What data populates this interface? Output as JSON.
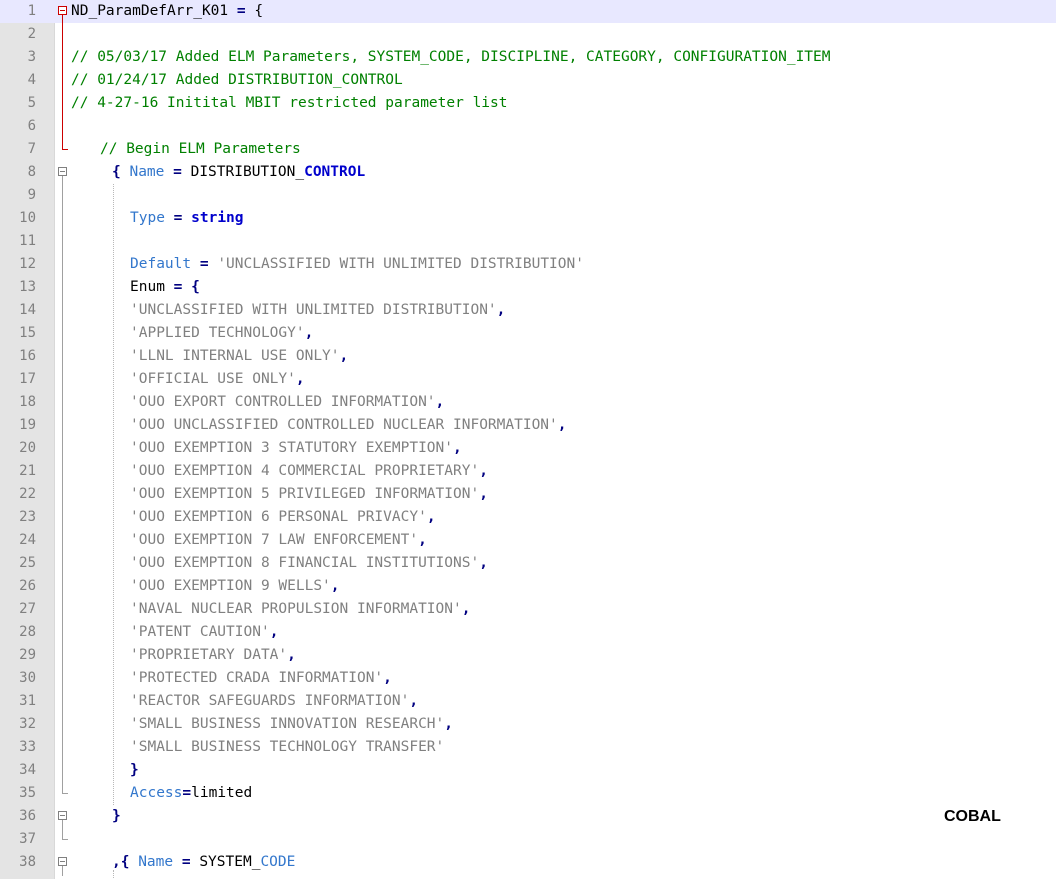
{
  "editor": {
    "lines": [
      {
        "n": "1",
        "indent": 0,
        "current": true,
        "tokens": [
          {
            "t": "ND_ParamDefArr_K01 ",
            "c": "id"
          },
          {
            "t": "=",
            "c": "op"
          },
          {
            "t": " {",
            "c": "id"
          }
        ]
      },
      {
        "n": "2",
        "indent": 0,
        "tokens": []
      },
      {
        "n": "3",
        "indent": 0,
        "tokens": [
          {
            "t": "// 05/03/17 Added ELM Parameters, SYSTEM_CODE, DISCIPLINE, CATEGORY, CONFIGURATION_ITEM",
            "c": "cmt"
          }
        ]
      },
      {
        "n": "4",
        "indent": 0,
        "tokens": [
          {
            "t": "// 01/24/17 Added DISTRIBUTION_CONTROL",
            "c": "cmt"
          }
        ]
      },
      {
        "n": "5",
        "indent": 0,
        "tokens": [
          {
            "t": "// 4-27-16 Initital MBIT restricted parameter list",
            "c": "cmt"
          }
        ]
      },
      {
        "n": "6",
        "indent": 0,
        "tokens": []
      },
      {
        "n": "7",
        "indent": 1,
        "tokens": [
          {
            "t": "// Begin ELM Parameters",
            "c": "cmt"
          }
        ]
      },
      {
        "n": "8",
        "indent": 2,
        "tokens": [
          {
            "t": "{ ",
            "c": "op"
          },
          {
            "t": "Name",
            "c": "kw"
          },
          {
            "t": " = ",
            "c": "op"
          },
          {
            "t": "DISTRIBUTION_",
            "c": "id"
          },
          {
            "t": "CONTROL",
            "c": "ctl"
          }
        ]
      },
      {
        "n": "9",
        "indent": 3,
        "tokens": []
      },
      {
        "n": "10",
        "indent": 3,
        "tokens": [
          {
            "t": "Type",
            "c": "kw"
          },
          {
            "t": " = ",
            "c": "op"
          },
          {
            "t": "string",
            "c": "type"
          }
        ]
      },
      {
        "n": "11",
        "indent": 3,
        "tokens": []
      },
      {
        "n": "12",
        "indent": 3,
        "tokens": [
          {
            "t": "Default",
            "c": "kw"
          },
          {
            "t": " = ",
            "c": "op"
          },
          {
            "t": "'UNCLASSIFIED WITH UNLIMITED DISTRIBUTION'",
            "c": "str"
          }
        ]
      },
      {
        "n": "13",
        "indent": 3,
        "tokens": [
          {
            "t": "Enum ",
            "c": "id"
          },
          {
            "t": "=",
            "c": "op"
          },
          {
            "t": " {",
            "c": "op"
          }
        ]
      },
      {
        "n": "14",
        "indent": 3,
        "tokens": [
          {
            "t": "'UNCLASSIFIED WITH UNLIMITED DISTRIBUTION'",
            "c": "str"
          },
          {
            "t": ",",
            "c": "op"
          }
        ]
      },
      {
        "n": "15",
        "indent": 3,
        "tokens": [
          {
            "t": "'APPLIED TECHNOLOGY'",
            "c": "str"
          },
          {
            "t": ",",
            "c": "op"
          }
        ]
      },
      {
        "n": "16",
        "indent": 3,
        "tokens": [
          {
            "t": "'LLNL INTERNAL USE ONLY'",
            "c": "str"
          },
          {
            "t": ",",
            "c": "op"
          }
        ]
      },
      {
        "n": "17",
        "indent": 3,
        "tokens": [
          {
            "t": "'OFFICIAL USE ONLY'",
            "c": "str"
          },
          {
            "t": ",",
            "c": "op"
          }
        ]
      },
      {
        "n": "18",
        "indent": 3,
        "tokens": [
          {
            "t": "'OUO EXPORT CONTROLLED INFORMATION'",
            "c": "str"
          },
          {
            "t": ",",
            "c": "op"
          }
        ]
      },
      {
        "n": "19",
        "indent": 3,
        "tokens": [
          {
            "t": "'OUO UNCLASSIFIED CONTROLLED NUCLEAR INFORMATION'",
            "c": "str"
          },
          {
            "t": ",",
            "c": "op"
          }
        ]
      },
      {
        "n": "20",
        "indent": 3,
        "tokens": [
          {
            "t": "'OUO EXEMPTION 3 STATUTORY EXEMPTION'",
            "c": "str"
          },
          {
            "t": ",",
            "c": "op"
          }
        ]
      },
      {
        "n": "21",
        "indent": 3,
        "tokens": [
          {
            "t": "'OUO EXEMPTION 4 COMMERCIAL PROPRIETARY'",
            "c": "str"
          },
          {
            "t": ",",
            "c": "op"
          }
        ]
      },
      {
        "n": "22",
        "indent": 3,
        "tokens": [
          {
            "t": "'OUO EXEMPTION 5 PRIVILEGED INFORMATION'",
            "c": "str"
          },
          {
            "t": ",",
            "c": "op"
          }
        ]
      },
      {
        "n": "23",
        "indent": 3,
        "tokens": [
          {
            "t": "'OUO EXEMPTION 6 PERSONAL PRIVACY'",
            "c": "str"
          },
          {
            "t": ",",
            "c": "op"
          }
        ]
      },
      {
        "n": "24",
        "indent": 3,
        "tokens": [
          {
            "t": "'OUO EXEMPTION 7 LAW ENFORCEMENT'",
            "c": "str"
          },
          {
            "t": ",",
            "c": "op"
          }
        ]
      },
      {
        "n": "25",
        "indent": 3,
        "tokens": [
          {
            "t": "'OUO EXEMPTION 8 FINANCIAL INSTITUTIONS'",
            "c": "str"
          },
          {
            "t": ",",
            "c": "op"
          }
        ]
      },
      {
        "n": "26",
        "indent": 3,
        "tokens": [
          {
            "t": "'OUO EXEMPTION 9 WELLS'",
            "c": "str"
          },
          {
            "t": ",",
            "c": "op"
          }
        ]
      },
      {
        "n": "27",
        "indent": 3,
        "tokens": [
          {
            "t": "'NAVAL NUCLEAR PROPULSION INFORMATION'",
            "c": "str"
          },
          {
            "t": ",",
            "c": "op"
          }
        ]
      },
      {
        "n": "28",
        "indent": 3,
        "tokens": [
          {
            "t": "'PATENT CAUTION'",
            "c": "str"
          },
          {
            "t": ",",
            "c": "op"
          }
        ]
      },
      {
        "n": "29",
        "indent": 3,
        "tokens": [
          {
            "t": "'PROPRIETARY DATA'",
            "c": "str"
          },
          {
            "t": ",",
            "c": "op"
          }
        ]
      },
      {
        "n": "30",
        "indent": 3,
        "tokens": [
          {
            "t": "'PROTECTED CRADA INFORMATION'",
            "c": "str"
          },
          {
            "t": ",",
            "c": "op"
          }
        ]
      },
      {
        "n": "31",
        "indent": 3,
        "tokens": [
          {
            "t": "'REACTOR SAFEGUARDS INFORMATION'",
            "c": "str"
          },
          {
            "t": ",",
            "c": "op"
          }
        ]
      },
      {
        "n": "32",
        "indent": 3,
        "tokens": [
          {
            "t": "'SMALL BUSINESS INNOVATION RESEARCH'",
            "c": "str"
          },
          {
            "t": ",",
            "c": "op"
          }
        ]
      },
      {
        "n": "33",
        "indent": 3,
        "tokens": [
          {
            "t": "'SMALL BUSINESS TECHNOLOGY TRANSFER'",
            "c": "str"
          }
        ]
      },
      {
        "n": "34",
        "indent": 3,
        "tokens": [
          {
            "t": "}",
            "c": "op"
          }
        ]
      },
      {
        "n": "35",
        "indent": 3,
        "tokens": [
          {
            "t": "Access",
            "c": "kw"
          },
          {
            "t": "=",
            "c": "op"
          },
          {
            "t": "limited",
            "c": "id"
          }
        ]
      },
      {
        "n": "36",
        "indent": 2,
        "tokens": [
          {
            "t": "}",
            "c": "op"
          }
        ]
      },
      {
        "n": "37",
        "indent": 2,
        "tokens": []
      },
      {
        "n": "38",
        "indent": 2,
        "tokens": [
          {
            "t": ",{ ",
            "c": "op"
          },
          {
            "t": "Name",
            "c": "kw"
          },
          {
            "t": " = ",
            "c": "op"
          },
          {
            "t": "SYSTEM_",
            "c": "id"
          },
          {
            "t": "CODE",
            "c": "kw"
          }
        ]
      }
    ]
  },
  "overlay": {
    "label": "COBAL"
  },
  "colors": {
    "comment": "#008000",
    "keyword": "#3377cc",
    "operator": "#000080",
    "string": "#808080",
    "current_line": "#e8e8ff",
    "fold_marker": "#cc0000"
  }
}
